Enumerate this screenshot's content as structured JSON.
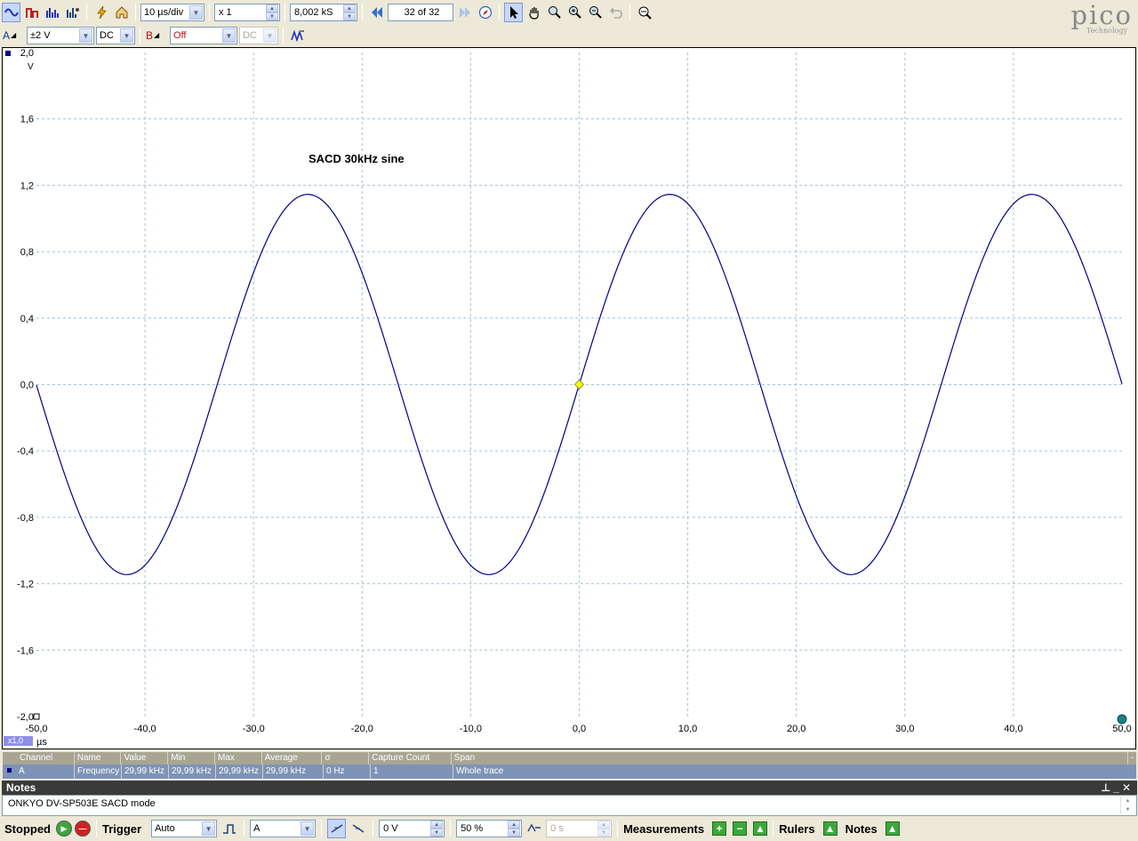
{
  "toolbar": {
    "timebase": "10 µs/div",
    "zoom_factor": "x 1",
    "samples": "8,002 kS",
    "buffer_position": "32 of 32"
  },
  "channels": {
    "a": {
      "label": "A",
      "range": "±2 V",
      "coupling": "DC"
    },
    "b": {
      "label": "B",
      "range": "Off",
      "coupling": "DC"
    }
  },
  "logo": {
    "name": "pico",
    "tagline": "Technology"
  },
  "colors": {
    "trace": "#00008b",
    "grid": "#9fc4d9",
    "trigger_marker": "#ffff00",
    "ruler_handle": "#1a8080"
  },
  "chart_data": {
    "type": "line",
    "annotation": "SACD 30kHz sine",
    "xlabel": "µs",
    "ylabel": "V",
    "xlim": [
      -50,
      50
    ],
    "ylim": [
      -2,
      2
    ],
    "x_ticks": [
      "-50,0",
      "-40,0",
      "-30,0",
      "-20,0",
      "-10,0",
      "0,0",
      "10,0",
      "20,0",
      "30,0",
      "40,0",
      "50,0"
    ],
    "y_ticks": [
      "2,0",
      "1,6",
      "1,2",
      "0,8",
      "0,4",
      "0,0",
      "-0,4",
      "-0,8",
      "-1,2",
      "-1,6",
      "-2,0"
    ],
    "grid": true,
    "series": [
      {
        "amplitude": 1.145,
        "frequency_khz": 29.99,
        "phase_at_zero": 0
      }
    ]
  },
  "x_scale_badge": "x1,0",
  "measurements": {
    "headers": [
      "Channel",
      "Name",
      "Value",
      "Min",
      "Max",
      "Average",
      "σ",
      "Capture Count",
      "Span"
    ],
    "rows": [
      [
        "A",
        "Frequency",
        "29,99 kHz",
        "29,99 kHz",
        "29,99 kHz",
        "29,99 kHz",
        "0 Hz",
        "1",
        "Whole trace"
      ]
    ],
    "collapse": "-"
  },
  "notes": {
    "title": "Notes",
    "text": "ONKYO DV-SP503E SACD mode"
  },
  "status": {
    "state": "Stopped",
    "trigger_label": "Trigger",
    "trigger_mode": "Auto",
    "trigger_source": "A",
    "trigger_level": "0 V",
    "pre_trigger": "50 %",
    "delay": "0 s",
    "measurements_label": "Measurements",
    "rulers_label": "Rulers",
    "notes_label": "Notes"
  }
}
